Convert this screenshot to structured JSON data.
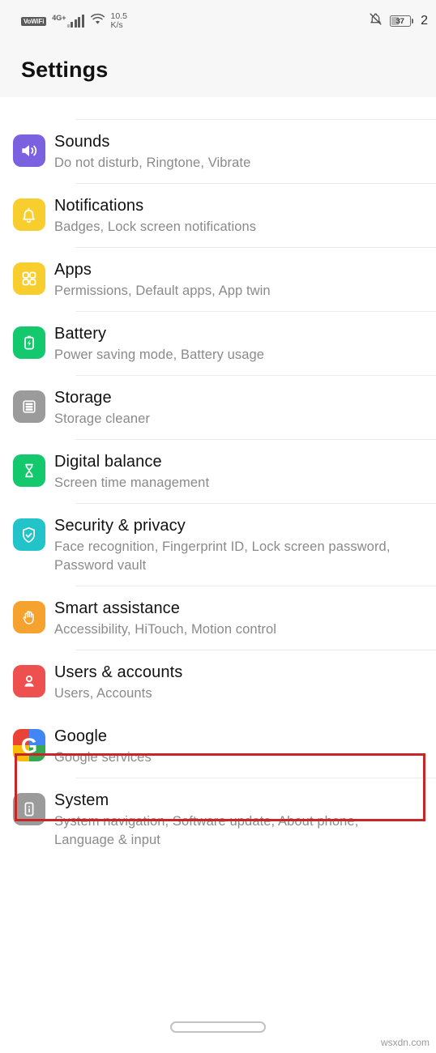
{
  "status_bar": {
    "volte_label": "VoWiFi",
    "network_label": "4G+",
    "data_speed_value": "10.5",
    "data_speed_unit": "K/s",
    "battery_percent": "37",
    "clock_partial": "2",
    "icons": [
      "volte-badge",
      "signal-bars-icon",
      "wifi-icon",
      "mute-bell-icon",
      "battery-icon"
    ]
  },
  "header": {
    "title": "Settings"
  },
  "list": {
    "cut_off_row_hint": "",
    "items": [
      {
        "title": "Sounds",
        "subtitle": "Do not disturb, Ringtone, Vibrate",
        "icon": "speaker-icon",
        "icon_color": "#7B61E0",
        "name": "sounds"
      },
      {
        "title": "Notifications",
        "subtitle": "Badges, Lock screen notifications",
        "icon": "bell-icon",
        "icon_color": "#F7CE2E",
        "name": "notifications"
      },
      {
        "title": "Apps",
        "subtitle": "Permissions, Default apps, App twin",
        "icon": "grid-apps-icon",
        "icon_color": "#F7CE2E",
        "name": "apps"
      },
      {
        "title": "Battery",
        "subtitle": "Power saving mode, Battery usage",
        "icon": "battery-bolt-icon",
        "icon_color": "#14C86E",
        "name": "battery"
      },
      {
        "title": "Storage",
        "subtitle": "Storage cleaner",
        "icon": "storage-stack-icon",
        "icon_color": "#9B9B9B",
        "name": "storage"
      },
      {
        "title": "Digital balance",
        "subtitle": "Screen time management",
        "icon": "hourglass-icon",
        "icon_color": "#14C86E",
        "name": "digital-balance"
      },
      {
        "title": "Security & privacy",
        "subtitle": "Face recognition, Fingerprint ID, Lock screen password, Password vault",
        "icon": "shield-check-icon",
        "icon_color": "#22C4C9",
        "name": "security-privacy"
      },
      {
        "title": "Smart assistance",
        "subtitle": "Accessibility, HiTouch, Motion control",
        "icon": "hand-icon",
        "icon_color": "#F5A32E",
        "name": "smart-assistance"
      },
      {
        "title": "Users & accounts",
        "subtitle": "Users, Accounts",
        "icon": "user-person-icon",
        "icon_color": "#EE4F4F",
        "name": "users-accounts"
      },
      {
        "title": "Google",
        "subtitle": "Google services",
        "icon": "google-g-icon",
        "icon_color": "#EA4335",
        "name": "google"
      },
      {
        "title": "System",
        "subtitle": "System navigation, Software update, About phone, Language & input",
        "icon": "phone-info-icon",
        "icon_color": "#9B9B9B",
        "name": "system"
      }
    ]
  },
  "annotation": {
    "highlight_color": "#C62626",
    "target": "Users & accounts"
  },
  "nav_bar": {
    "gesture_pill": "home-gesture-pill"
  },
  "watermark": {
    "text": "wsxdn.com"
  }
}
